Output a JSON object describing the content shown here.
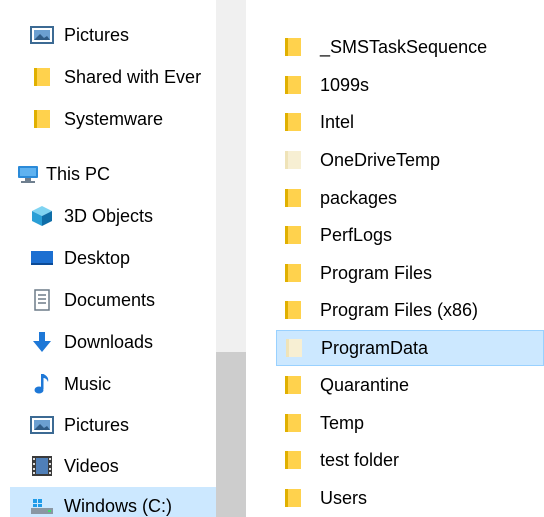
{
  "navigation_pane": {
    "items": [
      {
        "label": "Pictures",
        "icon": "pictures-icon"
      },
      {
        "label": "Shared with Ever",
        "icon": "folder-icon"
      },
      {
        "label": "Systemware",
        "icon": "folder-icon"
      },
      {
        "label": "This PC",
        "icon": "computer-icon"
      },
      {
        "label": "3D Objects",
        "icon": "3d-objects-icon"
      },
      {
        "label": "Desktop",
        "icon": "desktop-icon"
      },
      {
        "label": "Documents",
        "icon": "documents-icon"
      },
      {
        "label": "Downloads",
        "icon": "downloads-icon"
      },
      {
        "label": "Music",
        "icon": "music-icon"
      },
      {
        "label": "Pictures",
        "icon": "pictures-icon"
      },
      {
        "label": "Videos",
        "icon": "videos-icon"
      },
      {
        "label": "Windows (C:)",
        "icon": "drive-icon",
        "selected": true
      }
    ]
  },
  "file_list": {
    "items": [
      {
        "name": "_SMSTaskSequence"
      },
      {
        "name": "1099s"
      },
      {
        "name": "Intel"
      },
      {
        "name": "OneDriveTemp",
        "hidden_style": true
      },
      {
        "name": "packages"
      },
      {
        "name": "PerfLogs"
      },
      {
        "name": "Program Files"
      },
      {
        "name": "Program Files (x86)"
      },
      {
        "name": "ProgramData",
        "selected": true,
        "hidden_style": true
      },
      {
        "name": "Quarantine"
      },
      {
        "name": "Temp"
      },
      {
        "name": "test folder"
      },
      {
        "name": "Users"
      }
    ]
  },
  "colors": {
    "selection": "#cce8ff",
    "selection_border": "#99d1ff",
    "folder": "#ffd24d",
    "scrollbar_track": "#f0f0f0",
    "scrollbar_thumb": "#cdcdcd"
  }
}
